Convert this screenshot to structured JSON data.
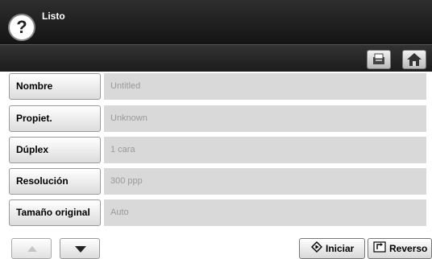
{
  "header": {
    "title": "Listo",
    "help_icon": "?"
  },
  "toolbar": {
    "icons": [
      "job-status-icon",
      "home-icon"
    ]
  },
  "settings": [
    {
      "label": "Nombre",
      "value": "Untitled"
    },
    {
      "label": "Propiet.",
      "value": "Unknown"
    },
    {
      "label": "Dúplex",
      "value": "1 cara"
    },
    {
      "label": "Resolución",
      "value": "300 ppp"
    },
    {
      "label": "Tamaño original",
      "value": "Auto"
    }
  ],
  "footer": {
    "start_label": "Iniciar",
    "reverse_label": "Reverso"
  }
}
